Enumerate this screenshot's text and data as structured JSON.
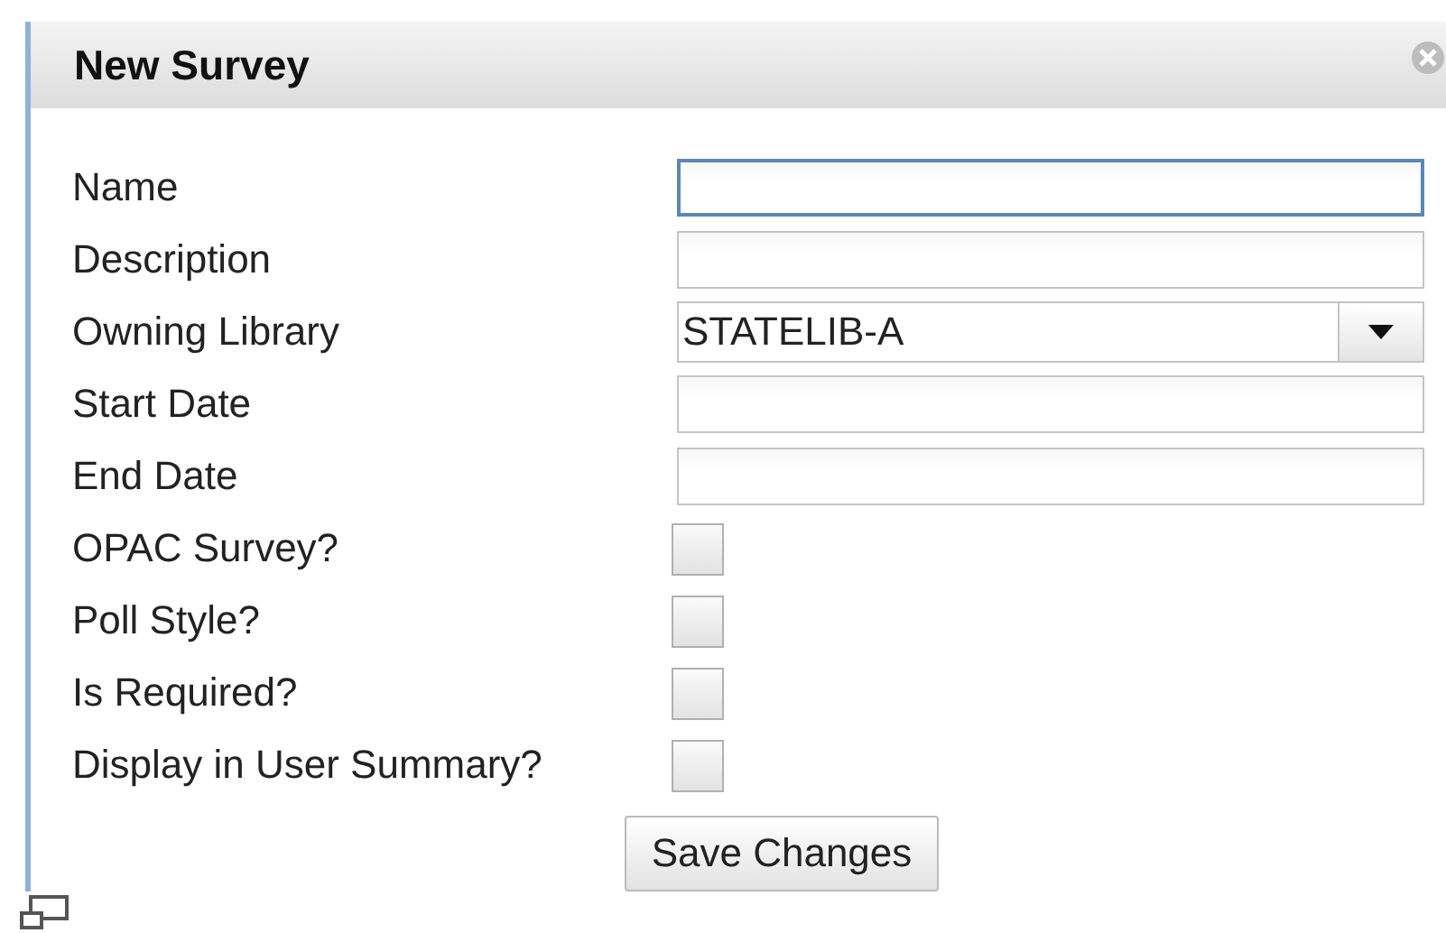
{
  "dialog": {
    "title": "New Survey"
  },
  "fields": [
    {
      "label": "Name",
      "kind": "text",
      "focused": true
    },
    {
      "label": "Description",
      "kind": "text",
      "focused": false
    },
    {
      "label": "Owning Library",
      "kind": "select",
      "value": "STATELIB-A"
    },
    {
      "label": "Start Date",
      "kind": "text",
      "focused": false
    },
    {
      "label": "End Date",
      "kind": "text",
      "focused": false
    },
    {
      "label": "OPAC Survey?",
      "kind": "checkbox",
      "checked": false
    },
    {
      "label": "Poll Style?",
      "kind": "checkbox",
      "checked": false
    },
    {
      "label": "Is Required?",
      "kind": "checkbox",
      "checked": false
    },
    {
      "label": "Display in User Summary?",
      "kind": "checkbox",
      "checked": false
    }
  ],
  "save_button": "Save Changes"
}
